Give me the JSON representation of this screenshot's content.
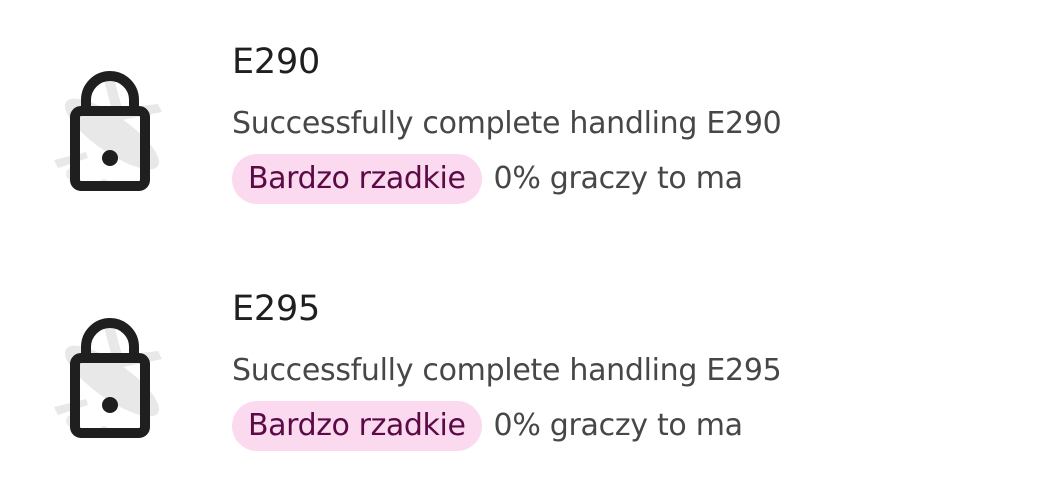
{
  "colors": {
    "badge_background": "#fbd9ef",
    "badge_text": "#5a0a45",
    "lock_icon": "#1f1f1f"
  },
  "achievements": [
    {
      "icon": "lock-icon",
      "title": "E290",
      "description": "Successfully complete handling E290",
      "rarity_label": "Bardzo rzadkie",
      "players_text": "0% graczy to ma"
    },
    {
      "icon": "lock-icon",
      "title": "E295",
      "description": "Successfully complete handling E295",
      "rarity_label": "Bardzo rzadkie",
      "players_text": "0% graczy to ma"
    }
  ]
}
